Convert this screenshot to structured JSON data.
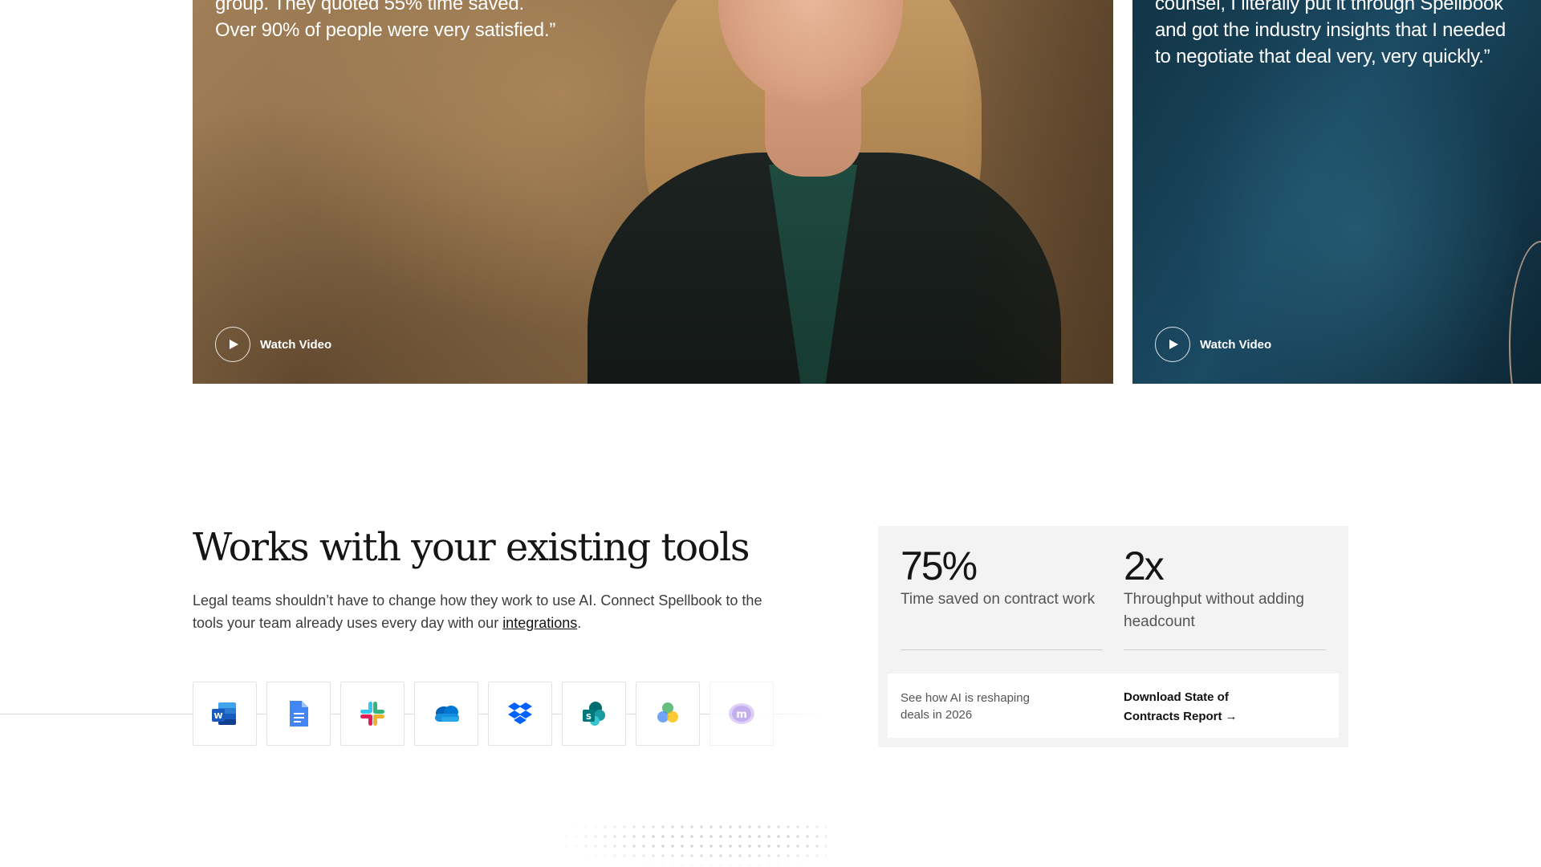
{
  "testimonials": [
    {
      "quote": "group. They quoted 55% time saved. Over 90% of people were very satisfied.”",
      "cta": "Watch Video"
    },
    {
      "quote": "counsel, I literally put it through Spellbook and got the industry insights that I needed to negotiate that deal very, very quickly.”",
      "cta": "Watch Video"
    }
  ],
  "tools_section": {
    "title": "Works with your existing tools",
    "description_before": "Legal teams shouldn’t have to change how they work to use AI. Connect Spellbook to the tools your team already uses every day with our ",
    "description_link": "integrations",
    "description_after": ".",
    "tools": [
      {
        "icon": "microsoft-word-icon"
      },
      {
        "icon": "google-docs-icon"
      },
      {
        "icon": "slack-icon"
      },
      {
        "icon": "onedrive-icon"
      },
      {
        "icon": "dropbox-icon"
      },
      {
        "icon": "sharepoint-icon"
      },
      {
        "icon": "google-drive-icon"
      },
      {
        "icon": "imanage-icon"
      }
    ]
  },
  "stats": [
    {
      "value": "75%",
      "label": "Time saved on contract work"
    },
    {
      "value": "2x",
      "label": "Throughput without adding headcount"
    }
  ],
  "report": {
    "note": "See how AI is reshaping deals in 2026",
    "link_label": "Download State of Contracts Report",
    "arrow": "→"
  },
  "colors": {
    "card_warm": "#8e6e4a",
    "card_cool": "#1b4a63",
    "panel_bg": "#f3f3f3",
    "text_dark": "#151515"
  }
}
